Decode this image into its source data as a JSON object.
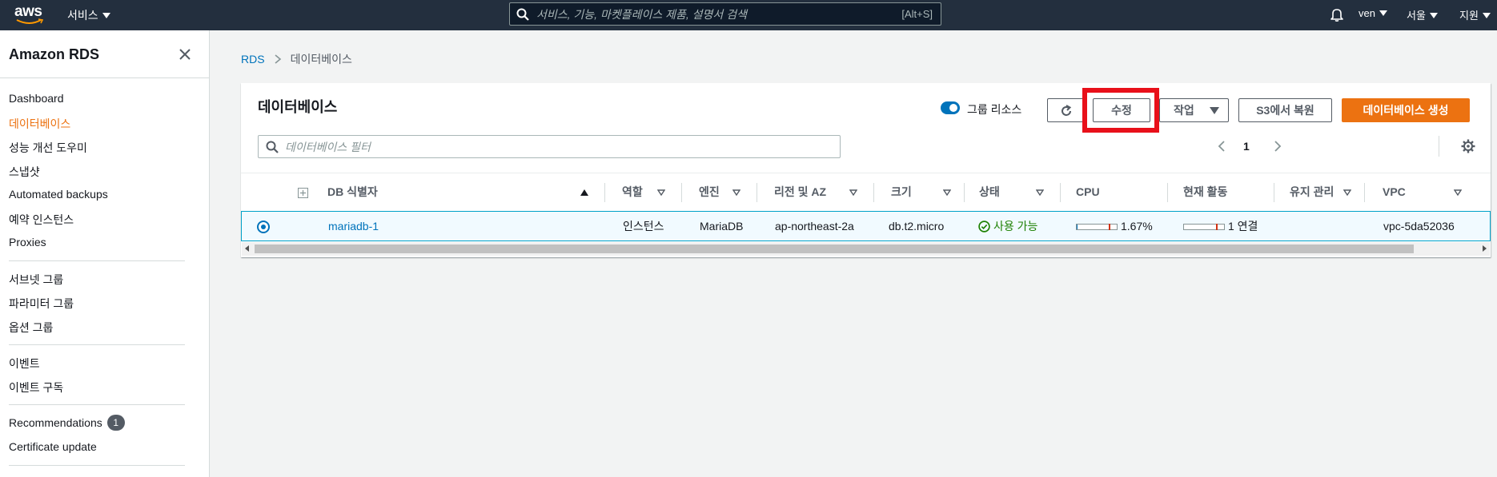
{
  "topnav": {
    "logo_text": "aws",
    "services_label": "서비스",
    "search_placeholder": "서비스, 기능, 마켓플레이스 제품, 설명서 검색",
    "search_shortcut": "[Alt+S]",
    "user_label": "ven",
    "region_label": "서울",
    "support_label": "지원"
  },
  "sidebar": {
    "title": "Amazon RDS",
    "items": [
      {
        "label": "Dashboard"
      },
      {
        "label": "데이터베이스",
        "active": true
      },
      {
        "label": "성능 개선 도우미"
      },
      {
        "label": "스냅샷"
      },
      {
        "label": "Automated backups"
      },
      {
        "label": "예약 인스턴스"
      },
      {
        "label": "Proxies"
      },
      {
        "label": "서브넷 그룹"
      },
      {
        "label": "파라미터 그룹"
      },
      {
        "label": "옵션 그룹"
      },
      {
        "label": "이벤트"
      },
      {
        "label": "이벤트 구독"
      },
      {
        "label": "Recommendations",
        "badge": "1"
      },
      {
        "label": "Certificate update"
      }
    ]
  },
  "breadcrumb": {
    "root": "RDS",
    "current": "데이터베이스"
  },
  "panel": {
    "title": "데이터베이스",
    "group_resources_label": "그룹 리소스",
    "group_resources_on": true,
    "modify_label": "수정",
    "actions_label": "작업",
    "restore_s3_label": "S3에서 복원",
    "create_label": "데이터베이스 생성",
    "filter_placeholder": "데이터베이스 필터",
    "page": "1"
  },
  "table": {
    "columns": [
      "DB 식별자",
      "역할",
      "엔진",
      "리전 및 AZ",
      "크기",
      "상태",
      "CPU",
      "현재 활동",
      "유지 관리",
      "VPC"
    ],
    "rows": [
      {
        "identifier": "mariadb-1",
        "role": "인스턴스",
        "engine": "MariaDB",
        "region_az": "ap-northeast-2a",
        "size": "db.t2.micro",
        "status": "사용 가능",
        "cpu": "1.67%",
        "cpu_fraction": 0.0167,
        "activity": "1 연결",
        "maintenance": "",
        "vpc": "vpc-5da52036"
      }
    ]
  },
  "colors": {
    "nav_bg": "#232f3e",
    "accent_orange": "#ec7211",
    "link_blue": "#0073bb",
    "status_green": "#1d8102",
    "highlight_red": "#e8101a"
  }
}
